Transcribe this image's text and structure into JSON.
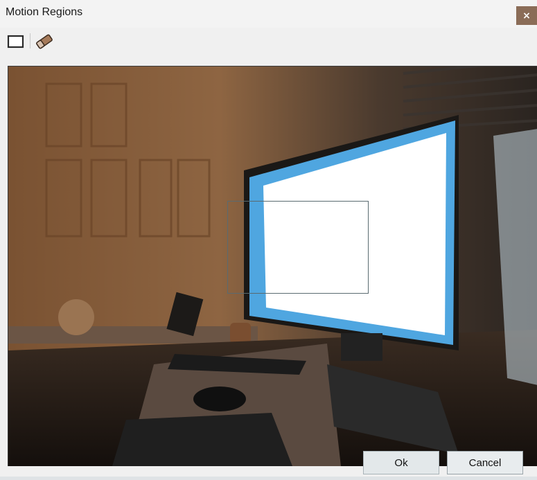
{
  "window": {
    "title": "Motion Regions",
    "close_label": "×"
  },
  "toolbar": {
    "tools": [
      {
        "name": "rectangle-tool",
        "icon": "rectangle-icon"
      },
      {
        "name": "eraser-tool",
        "icon": "eraser-icon"
      }
    ]
  },
  "footer": {
    "ok_label": "Ok",
    "cancel_label": "Cancel"
  },
  "colors": {
    "close_button": "#8a6c57",
    "region_border": "#5a6a70"
  }
}
